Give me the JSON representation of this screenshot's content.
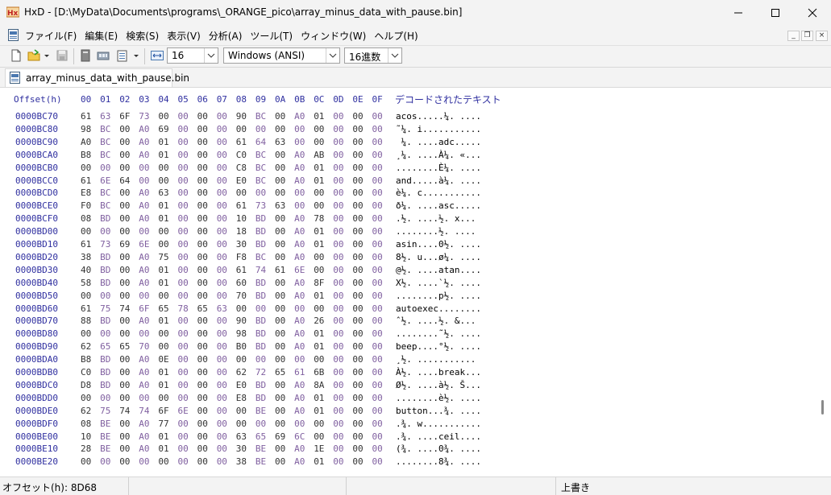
{
  "window": {
    "title": "HxD - [D:\\MyData\\Documents\\programs\\_ORANGE_pico\\array_minus_data_with_pause.bin]"
  },
  "menu": [
    "ファイル(F)",
    "編集(E)",
    "検索(S)",
    "表示(V)",
    "分析(A)",
    "ツール(T)",
    "ウィンドウ(W)",
    "ヘルプ(H)"
  ],
  "toolbar": {
    "bytes_per_row": "16",
    "charset": "Windows (ANSI)",
    "offset_base": "16進数"
  },
  "tab": {
    "label": "array_minus_data_with_pause.bin"
  },
  "hex": {
    "offset_header": "Offset(h)",
    "columns": [
      "00",
      "01",
      "02",
      "03",
      "04",
      "05",
      "06",
      "07",
      "08",
      "09",
      "0A",
      "0B",
      "0C",
      "0D",
      "0E",
      "0F"
    ],
    "decoded_header": "デコードされたテキスト",
    "rows": [
      {
        "offset": "0000BC70",
        "bytes": [
          "61",
          "63",
          "6F",
          "73",
          "00",
          "00",
          "00",
          "00",
          "90",
          "BC",
          "00",
          "A0",
          "01",
          "00",
          "00",
          "00"
        ],
        "text": "acos.....¼. ...."
      },
      {
        "offset": "0000BC80",
        "bytes": [
          "98",
          "BC",
          "00",
          "A0",
          "69",
          "00",
          "00",
          "00",
          "00",
          "00",
          "00",
          "00",
          "00",
          "00",
          "00",
          "00"
        ],
        "text": "˜¼. i..........."
      },
      {
        "offset": "0000BC90",
        "bytes": [
          "A0",
          "BC",
          "00",
          "A0",
          "01",
          "00",
          "00",
          "00",
          "61",
          "64",
          "63",
          "00",
          "00",
          "00",
          "00",
          "00"
        ],
        "text": " ¼. ....adc....."
      },
      {
        "offset": "0000BCA0",
        "bytes": [
          "B8",
          "BC",
          "00",
          "A0",
          "01",
          "00",
          "00",
          "00",
          "C0",
          "BC",
          "00",
          "A0",
          "AB",
          "00",
          "00",
          "00"
        ],
        "text": "¸¼. ....À¼. «..."
      },
      {
        "offset": "0000BCB0",
        "bytes": [
          "00",
          "00",
          "00",
          "00",
          "00",
          "00",
          "00",
          "00",
          "C8",
          "BC",
          "00",
          "A0",
          "01",
          "00",
          "00",
          "00"
        ],
        "text": "........È¼. ...."
      },
      {
        "offset": "0000BCC0",
        "bytes": [
          "61",
          "6E",
          "64",
          "00",
          "00",
          "00",
          "00",
          "00",
          "E0",
          "BC",
          "00",
          "A0",
          "01",
          "00",
          "00",
          "00"
        ],
        "text": "and.....à¼. ...."
      },
      {
        "offset": "0000BCD0",
        "bytes": [
          "E8",
          "BC",
          "00",
          "A0",
          "63",
          "00",
          "00",
          "00",
          "00",
          "00",
          "00",
          "00",
          "00",
          "00",
          "00",
          "00"
        ],
        "text": "è¼. c..........."
      },
      {
        "offset": "0000BCE0",
        "bytes": [
          "F0",
          "BC",
          "00",
          "A0",
          "01",
          "00",
          "00",
          "00",
          "61",
          "73",
          "63",
          "00",
          "00",
          "00",
          "00",
          "00"
        ],
        "text": "ð¼. ....asc....."
      },
      {
        "offset": "0000BCF0",
        "bytes": [
          "08",
          "BD",
          "00",
          "A0",
          "01",
          "00",
          "00",
          "00",
          "10",
          "BD",
          "00",
          "A0",
          "78",
          "00",
          "00",
          "00"
        ],
        "text": ".½. ....½. x..."
      },
      {
        "offset": "0000BD00",
        "bytes": [
          "00",
          "00",
          "00",
          "00",
          "00",
          "00",
          "00",
          "00",
          "18",
          "BD",
          "00",
          "A0",
          "01",
          "00",
          "00",
          "00"
        ],
        "text": "........½. ...."
      },
      {
        "offset": "0000BD10",
        "bytes": [
          "61",
          "73",
          "69",
          "6E",
          "00",
          "00",
          "00",
          "00",
          "30",
          "BD",
          "00",
          "A0",
          "01",
          "00",
          "00",
          "00"
        ],
        "text": "asin....0½. ...."
      },
      {
        "offset": "0000BD20",
        "bytes": [
          "38",
          "BD",
          "00",
          "A0",
          "75",
          "00",
          "00",
          "00",
          "F8",
          "BC",
          "00",
          "A0",
          "00",
          "00",
          "00",
          "00"
        ],
        "text": "8½. u...ø¼. ...."
      },
      {
        "offset": "0000BD30",
        "bytes": [
          "40",
          "BD",
          "00",
          "A0",
          "01",
          "00",
          "00",
          "00",
          "61",
          "74",
          "61",
          "6E",
          "00",
          "00",
          "00",
          "00"
        ],
        "text": "@½. ....atan...."
      },
      {
        "offset": "0000BD40",
        "bytes": [
          "58",
          "BD",
          "00",
          "A0",
          "01",
          "00",
          "00",
          "00",
          "60",
          "BD",
          "00",
          "A0",
          "8F",
          "00",
          "00",
          "00"
        ],
        "text": "X½. ....`½. ...."
      },
      {
        "offset": "0000BD50",
        "bytes": [
          "00",
          "00",
          "00",
          "00",
          "00",
          "00",
          "00",
          "00",
          "70",
          "BD",
          "00",
          "A0",
          "01",
          "00",
          "00",
          "00"
        ],
        "text": "........p½. ...."
      },
      {
        "offset": "0000BD60",
        "bytes": [
          "61",
          "75",
          "74",
          "6F",
          "65",
          "78",
          "65",
          "63",
          "00",
          "00",
          "00",
          "00",
          "00",
          "00",
          "00",
          "00"
        ],
        "text": "autoexec........"
      },
      {
        "offset": "0000BD70",
        "bytes": [
          "88",
          "BD",
          "00",
          "A0",
          "01",
          "00",
          "00",
          "00",
          "90",
          "BD",
          "00",
          "A0",
          "26",
          "00",
          "00",
          "00"
        ],
        "text": "ˆ½. ....½. &..."
      },
      {
        "offset": "0000BD80",
        "bytes": [
          "00",
          "00",
          "00",
          "00",
          "00",
          "00",
          "00",
          "00",
          "98",
          "BD",
          "00",
          "A0",
          "01",
          "00",
          "00",
          "00"
        ],
        "text": "........˜½. ...."
      },
      {
        "offset": "0000BD90",
        "bytes": [
          "62",
          "65",
          "65",
          "70",
          "00",
          "00",
          "00",
          "00",
          "B0",
          "BD",
          "00",
          "A0",
          "01",
          "00",
          "00",
          "00"
        ],
        "text": "beep....°½. ...."
      },
      {
        "offset": "0000BDA0",
        "bytes": [
          "B8",
          "BD",
          "00",
          "A0",
          "0E",
          "00",
          "00",
          "00",
          "00",
          "00",
          "00",
          "00",
          "00",
          "00",
          "00",
          "00"
        ],
        "text": "¸½. ..........."
      },
      {
        "offset": "0000BDB0",
        "bytes": [
          "C0",
          "BD",
          "00",
          "A0",
          "01",
          "00",
          "00",
          "00",
          "62",
          "72",
          "65",
          "61",
          "6B",
          "00",
          "00",
          "00"
        ],
        "text": "À½. ....break..."
      },
      {
        "offset": "0000BDC0",
        "bytes": [
          "D8",
          "BD",
          "00",
          "A0",
          "01",
          "00",
          "00",
          "00",
          "E0",
          "BD",
          "00",
          "A0",
          "8A",
          "00",
          "00",
          "00"
        ],
        "text": "Ø½. ....à½. Š..."
      },
      {
        "offset": "0000BDD0",
        "bytes": [
          "00",
          "00",
          "00",
          "00",
          "00",
          "00",
          "00",
          "00",
          "E8",
          "BD",
          "00",
          "A0",
          "01",
          "00",
          "00",
          "00"
        ],
        "text": "........è½. ...."
      },
      {
        "offset": "0000BDE0",
        "bytes": [
          "62",
          "75",
          "74",
          "74",
          "6F",
          "6E",
          "00",
          "00",
          "00",
          "BE",
          "00",
          "A0",
          "01",
          "00",
          "00",
          "00"
        ],
        "text": "button...¾. ...."
      },
      {
        "offset": "0000BDF0",
        "bytes": [
          "08",
          "BE",
          "00",
          "A0",
          "77",
          "00",
          "00",
          "00",
          "00",
          "00",
          "00",
          "00",
          "00",
          "00",
          "00",
          "00"
        ],
        "text": ".¾. w..........."
      },
      {
        "offset": "0000BE00",
        "bytes": [
          "10",
          "BE",
          "00",
          "A0",
          "01",
          "00",
          "00",
          "00",
          "63",
          "65",
          "69",
          "6C",
          "00",
          "00",
          "00",
          "00"
        ],
        "text": ".¾. ....ceil...."
      },
      {
        "offset": "0000BE10",
        "bytes": [
          "28",
          "BE",
          "00",
          "A0",
          "01",
          "00",
          "00",
          "00",
          "30",
          "BE",
          "00",
          "A0",
          "1E",
          "00",
          "00",
          "00"
        ],
        "text": "(¾. ....0¾. ...."
      },
      {
        "offset": "0000BE20",
        "bytes": [
          "00",
          "00",
          "00",
          "00",
          "00",
          "00",
          "00",
          "00",
          "38",
          "BE",
          "00",
          "A0",
          "01",
          "00",
          "00",
          "00"
        ],
        "text": "........8¾. ...."
      }
    ]
  },
  "status": {
    "offset": "オフセット(h): 8D68",
    "mode": "上書き"
  }
}
